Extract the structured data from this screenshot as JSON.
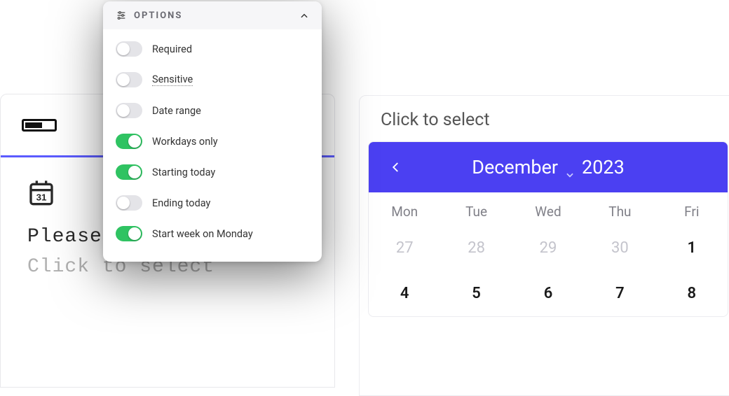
{
  "colors": {
    "accent": "#4b40f2",
    "toggle_on": "#2fc362"
  },
  "options_panel": {
    "title": "OPTIONS",
    "items": [
      {
        "label": "Required",
        "on": false,
        "id": "required"
      },
      {
        "label": "Sensitive",
        "on": false,
        "id": "sensitive",
        "dotted": true
      },
      {
        "label": "Date range",
        "on": false,
        "id": "date-range"
      },
      {
        "label": "Workdays only",
        "on": true,
        "id": "workdays-only"
      },
      {
        "label": "Starting today",
        "on": true,
        "id": "starting-today"
      },
      {
        "label": "Ending today",
        "on": false,
        "id": "ending-today"
      },
      {
        "label": "Start week on Monday",
        "on": true,
        "id": "start-week-monday"
      }
    ]
  },
  "form": {
    "calendar_day": "31",
    "prompt": "Please select a date",
    "placeholder": "Click to select"
  },
  "calendar": {
    "select_label": "Click to select",
    "month": "December",
    "year": "2023",
    "daynames": [
      "Mon",
      "Tue",
      "Wed",
      "Thu",
      "Fri"
    ],
    "rows": [
      [
        {
          "d": "27",
          "muted": true
        },
        {
          "d": "28",
          "muted": true
        },
        {
          "d": "29",
          "muted": true
        },
        {
          "d": "30",
          "muted": true
        },
        {
          "d": "1",
          "muted": false
        }
      ],
      [
        {
          "d": "4",
          "muted": false
        },
        {
          "d": "5",
          "muted": false
        },
        {
          "d": "6",
          "muted": false
        },
        {
          "d": "7",
          "muted": false
        },
        {
          "d": "8",
          "muted": false
        }
      ]
    ]
  }
}
